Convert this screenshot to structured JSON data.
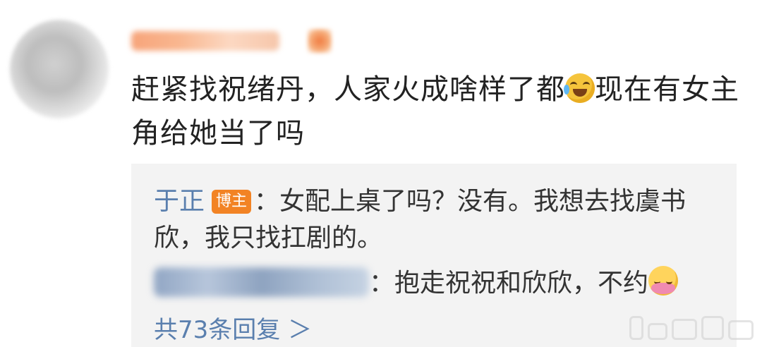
{
  "comment": {
    "text_part1": "赶紧找祝绪丹，人家火成啥样了都",
    "emoji_1": "laughing-crying-emoji",
    "text_part2": "现在有女主角给她当了吗"
  },
  "replies": [
    {
      "name": "于正",
      "badge": "博主",
      "separator": "：",
      "text": "女配上桌了吗？没有。我想去找虞书欣，我只找扛剧的。"
    },
    {
      "name_blurred": true,
      "separator": "：",
      "text": "抱走祝祝和欣欣，不约",
      "emoji": "shy-blush-emoji"
    }
  ],
  "more_replies": "共73条回复 ＞",
  "colors": {
    "link": "#5a7fae",
    "badge": "#f28324",
    "reply_bg": "#f3f3f3",
    "text": "#222222"
  }
}
